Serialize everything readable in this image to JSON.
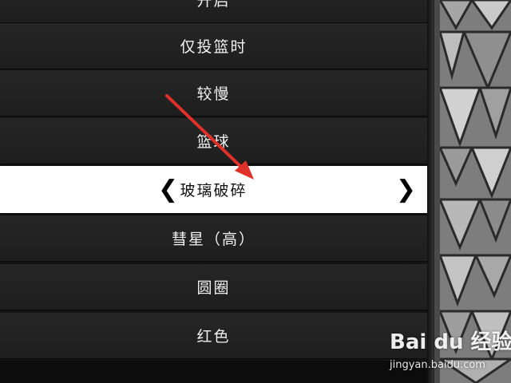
{
  "menu": {
    "items": [
      {
        "label": "开启"
      },
      {
        "label": "仅投篮时"
      },
      {
        "label": "较慢"
      },
      {
        "label": "篮球"
      },
      {
        "label": "玻璃破碎",
        "selected": true
      },
      {
        "label": "彗星（高）"
      },
      {
        "label": "圆圈"
      },
      {
        "label": "红色"
      }
    ],
    "prev_glyph": "❮",
    "next_glyph": "❯"
  },
  "watermark": {
    "logo_text": "Bai du 经验",
    "url_text": "jingyan.baidu.com"
  },
  "colors": {
    "row_background": "#222222",
    "selected_background": "#ffffff",
    "annotation_arrow": "#e0302a"
  }
}
